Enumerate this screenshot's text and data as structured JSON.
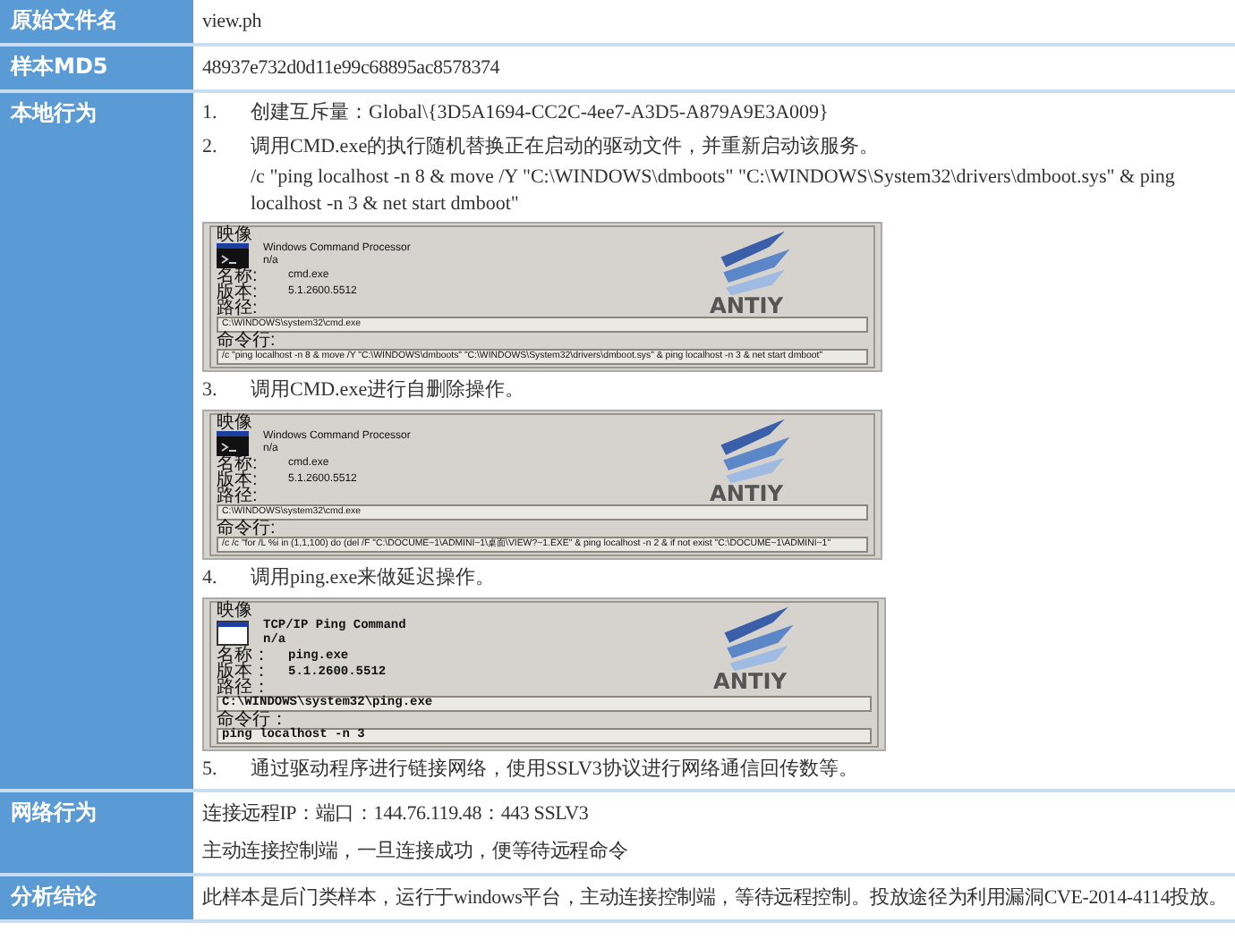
{
  "rows": [
    {
      "kind": "text",
      "label": "原始文件名",
      "lines": [
        "view.ph"
      ]
    },
    {
      "kind": "text",
      "label": "样本MD5",
      "lines": [
        "48937e732d0d11e99c68895ac8578374"
      ]
    },
    {
      "kind": "list",
      "label": "本地行为",
      "items": [
        {
          "kind": "step",
          "number": "1.",
          "text": "创建互斥量：Global\\{3D5A1694-CC2C-4ee7-A3D5-A879A9E3A009}"
        },
        {
          "kind": "step",
          "number": "2.",
          "text": "调用CMD.exe的执行随机替换正在启动的驱动文件，并重新启动该服务。"
        },
        {
          "kind": "command",
          "text": "/c \"ping localhost -n 8 & move /Y \"C:\\WINDOWS\\dmboots\" \"C:\\WINDOWS\\System32\\drivers\\dmboot.sys\" & ping localhost -n 3 & net start dmboot\""
        },
        {
          "kind": "console_screenshot",
          "legend": "映像",
          "description": "Windows Command Processor",
          "company": "n/a",
          "name_label": "名称:",
          "name": "cmd.exe",
          "version_label": "版本:",
          "version": "5.1.2600.5512",
          "path_label": "路径:",
          "path": "C:\\WINDOWS\\system32\\cmd.exe",
          "cmdline_label": "命令行:",
          "cmdline": "/c \"ping localhost -n 8 & move /Y \"C:\\WINDOWS\\dmboots\" \"C:\\WINDOWS\\System32\\drivers\\dmboot.sys\" & ping localhost -n 3 & net start dmboot\"",
          "logo": "ANTIY"
        },
        {
          "kind": "step",
          "number": "3.",
          "text": "调用CMD.exe进行自删除操作。"
        },
        {
          "kind": "console_screenshot",
          "legend": "映像",
          "description": "Windows Command Processor",
          "company": "n/a",
          "name_label": "名称:",
          "name": "cmd.exe",
          "version_label": "版本:",
          "version": "5.1.2600.5512",
          "path_label": "路径:",
          "path": "C:\\WINDOWS\\system32\\cmd.exe",
          "cmdline_label": "命令行:",
          "cmdline": "/c /c \"for /L %i in (1,1,100) do (del /F \"C:\\DOCUME~1\\ADMINI~1\\桌面\\VIEW?~1.EXE\" & ping localhost -n 2 & if not exist \"C:\\DOCUME~1\\ADMINI~1\"",
          "logo": "ANTIY"
        },
        {
          "kind": "step",
          "number": "4.",
          "text": "调用ping.exe来做延迟操作。"
        },
        {
          "kind": "window_screenshot",
          "legend": "映像",
          "description": "TCP/IP Ping Command",
          "company": "n/a",
          "name_label": "名称：",
          "name": "ping.exe",
          "version_label": "版本：",
          "version": "5.1.2600.5512",
          "path_label": "路径：",
          "path": "C:\\WINDOWS\\system32\\ping.exe",
          "cmdline_label": "命令行：",
          "cmdline": "ping localhost -n 3",
          "logo": "ANTIY"
        },
        {
          "kind": "step",
          "number": "5.",
          "text": "通过驱动程序进行链接网络，使用SSLV3协议进行网络通信回传数等。"
        }
      ]
    },
    {
      "kind": "text",
      "label": "网络行为",
      "lines": [
        "连接远程IP：端口：144.76.119.48：443 SSLV3",
        "主动连接控制端，一旦连接成功，便等待远程命令"
      ]
    },
    {
      "kind": "text",
      "label": "分析结论",
      "lines": [
        "此样本是后门类样本，运行于windows平台，主动连接控制端，等待远程控制。投放途径为利用漏洞CVE-2014-4114投放。"
      ]
    }
  ]
}
